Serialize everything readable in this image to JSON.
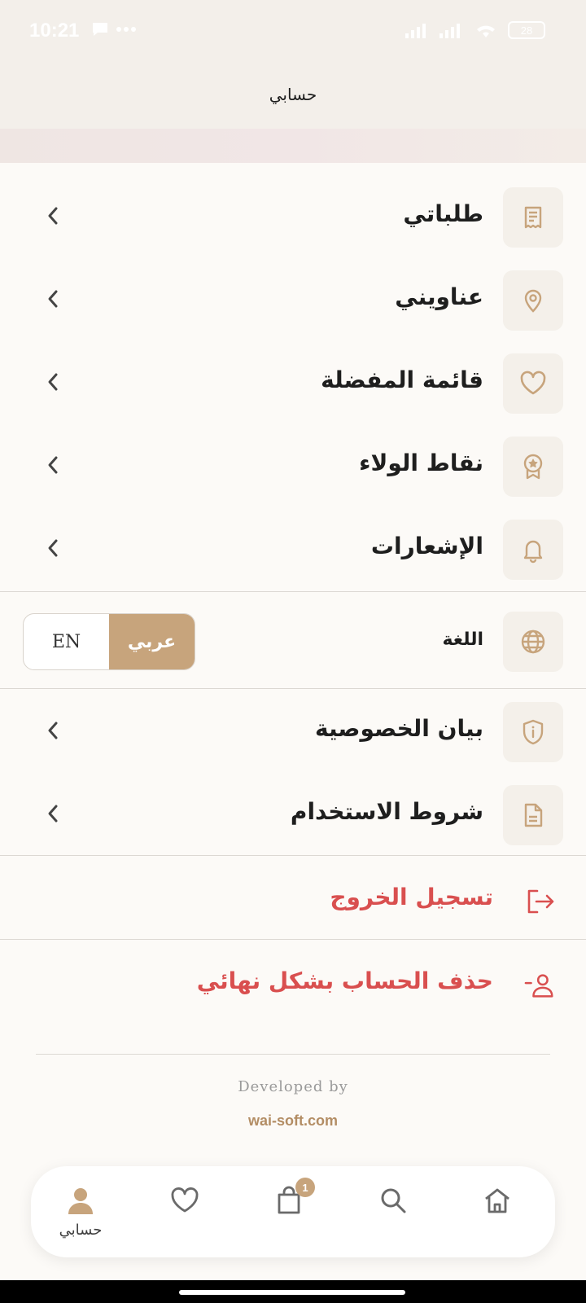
{
  "status": {
    "time": "10:21",
    "battery": "28"
  },
  "header": {
    "title": "حسابي"
  },
  "menu": {
    "items": [
      {
        "label": "طلباتي",
        "icon": "receipt-icon"
      },
      {
        "label": "عناويني",
        "icon": "location-pin-icon"
      },
      {
        "label": "قائمة المفضلة",
        "icon": "heart-icon"
      },
      {
        "label": "نقاط الولاء",
        "icon": "badge-star-icon"
      },
      {
        "label": "الإشعارات",
        "icon": "bell-icon"
      }
    ],
    "language": {
      "label": "اللغة",
      "options": [
        "عربي",
        "EN"
      ],
      "selected": "عربي"
    },
    "legal": [
      {
        "label": "بيان الخصوصية",
        "icon": "shield-info-icon"
      },
      {
        "label": "شروط الاستخدام",
        "icon": "document-icon"
      }
    ],
    "logout": {
      "label": "تسجيل الخروج",
      "icon": "logout-icon"
    },
    "delete_account": {
      "label": "حذف الحساب بشكل نهائي",
      "icon": "user-minus-icon"
    }
  },
  "footer": {
    "developed_by": "Developed by",
    "site": "wai-soft.com"
  },
  "bottom_nav": {
    "items": [
      {
        "name": "account",
        "label": "حسابي",
        "icon": "user-icon",
        "active": true
      },
      {
        "name": "favorites",
        "icon": "heart-icon"
      },
      {
        "name": "cart",
        "icon": "shopping-bag-icon",
        "badge": "1"
      },
      {
        "name": "search",
        "icon": "search-icon"
      },
      {
        "name": "home",
        "icon": "home-icon"
      }
    ]
  },
  "colors": {
    "accent": "#c7a47c",
    "danger": "#d94f4f",
    "icon_bg": "#f4f0ea"
  }
}
